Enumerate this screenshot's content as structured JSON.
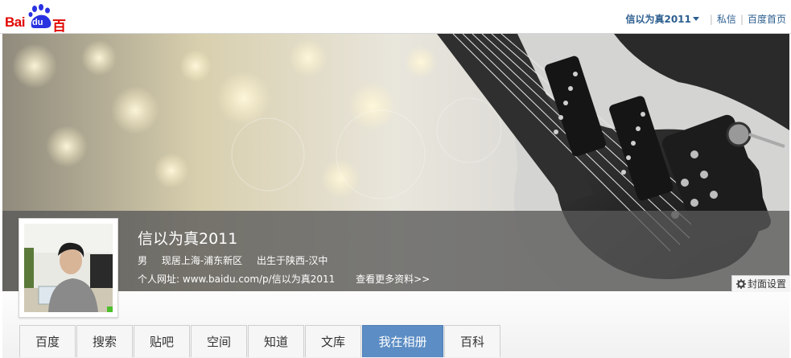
{
  "logo": {
    "text_latin": "Bai",
    "text_du": "du",
    "text_cn": "百度"
  },
  "topnav": {
    "username": "信以为真2011",
    "messages": "私信",
    "home": "百度首页",
    "separator": "|"
  },
  "profile": {
    "name": "信以为真2011",
    "gender": "男",
    "residence": "现居上海-浦东新区",
    "birthplace": "出生于陕西-汉中",
    "homepage_label": "个人网址:",
    "homepage_url": "www.baidu.com/p/信以为真2011",
    "more_link": "查看更多资料>>"
  },
  "cover_settings": {
    "label": "封面设置",
    "icon": "gear-icon"
  },
  "tabs": [
    {
      "label": "百度"
    },
    {
      "label": "搜索"
    },
    {
      "label": "贴吧"
    },
    {
      "label": "空间"
    },
    {
      "label": "知道"
    },
    {
      "label": "文库"
    },
    {
      "label": "我在相册",
      "active": true
    },
    {
      "label": "百科"
    }
  ],
  "colors": {
    "brand_red": "#e10601",
    "brand_blue": "#2c5e8f",
    "tab_active": "#5c8dc4",
    "online": "#4cbf2a"
  }
}
